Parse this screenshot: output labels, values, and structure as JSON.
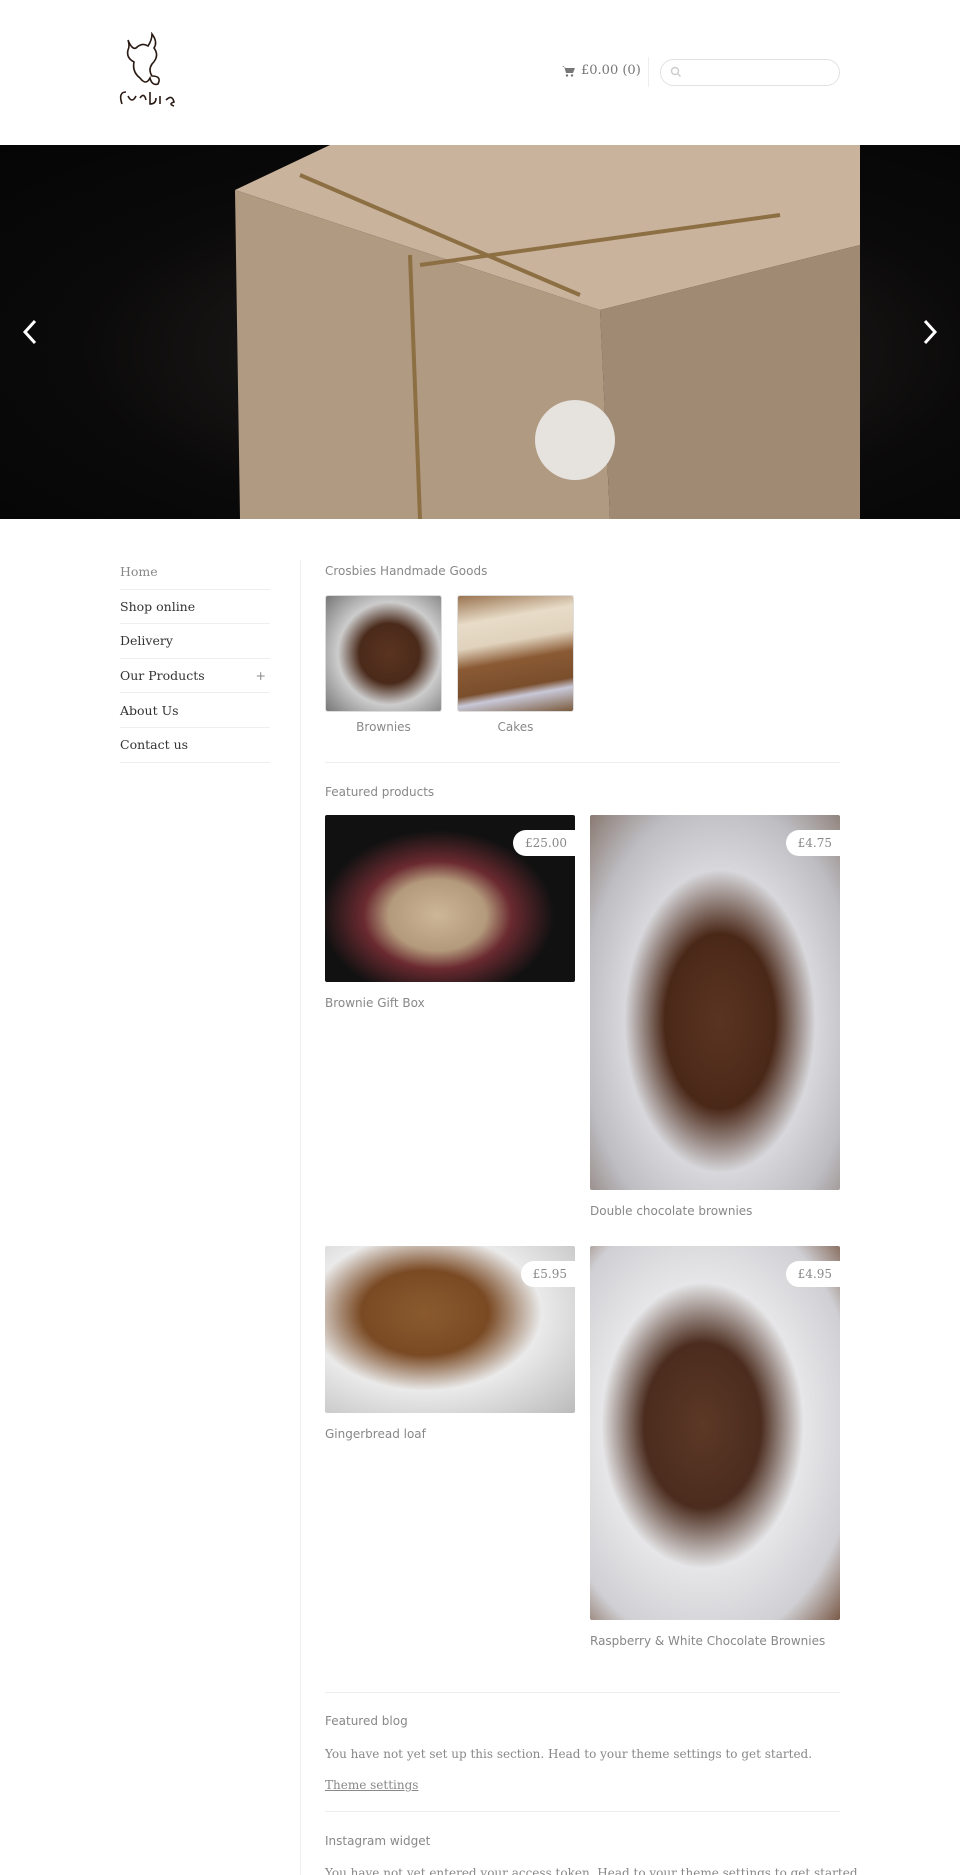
{
  "header": {
    "logo_text": "Crosbies",
    "cart_label": "£0.00 (0)",
    "search_placeholder": ""
  },
  "hero": {
    "prev_icon": "chevron-left-icon",
    "next_icon": "chevron-right-icon"
  },
  "sidebar": {
    "items": [
      {
        "label": "Home"
      },
      {
        "label": "Shop online"
      },
      {
        "label": "Delivery"
      },
      {
        "label": "Our Products",
        "expand": "+"
      },
      {
        "label": "About Us"
      },
      {
        "label": "Contact us"
      }
    ]
  },
  "collections": {
    "title": "Crosbies Handmade Goods",
    "items": [
      {
        "label": "Brownies"
      },
      {
        "label": "Cakes"
      }
    ]
  },
  "featured": {
    "title": "Featured products",
    "items": [
      {
        "name": "Brownie Gift Box",
        "price": "£25.00"
      },
      {
        "name": "Double chocolate brownies",
        "price": "£4.75"
      },
      {
        "name": "Gingerbread loaf",
        "price": "£5.95"
      },
      {
        "name": "Raspberry & White Chocolate Brownies",
        "price": "£4.95"
      }
    ]
  },
  "blog": {
    "title": "Featured blog",
    "text": "You have not yet set up this section. Head to your theme settings to get started.",
    "link": "Theme settings"
  },
  "instagram": {
    "title": "Instagram widget",
    "text": "You have not yet entered your access token. Head to your theme settings to get started."
  }
}
